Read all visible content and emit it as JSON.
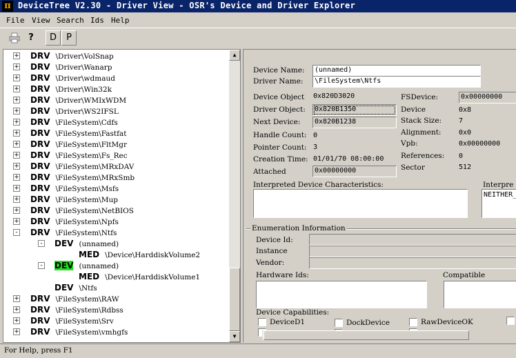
{
  "window": {
    "title": "DeviceTree V2.30 - Driver View - OSR's Device and Driver Explorer",
    "icon_glyph": "π"
  },
  "menu": [
    "File",
    "View",
    "Search",
    "Ids",
    "Help"
  ],
  "toolbar": {
    "print_icon": "printer-icon",
    "help_glyph": "?",
    "d_label": "D",
    "p_label": "P"
  },
  "tree": [
    {
      "level": 0,
      "expander": "+",
      "tag": "DRV",
      "path": "\\Driver\\VolSnap"
    },
    {
      "level": 0,
      "expander": "+",
      "tag": "DRV",
      "path": "\\Driver\\Wanarp"
    },
    {
      "level": 0,
      "expander": "+",
      "tag": "DRV",
      "path": "\\Driver\\wdmaud"
    },
    {
      "level": 0,
      "expander": "+",
      "tag": "DRV",
      "path": "\\Driver\\Win32k"
    },
    {
      "level": 0,
      "expander": "+",
      "tag": "DRV",
      "path": "\\Driver\\WMIxWDM"
    },
    {
      "level": 0,
      "expander": "+",
      "tag": "DRV",
      "path": "\\Driver\\WS2IFSL"
    },
    {
      "level": 0,
      "expander": "+",
      "tag": "DRV",
      "path": "\\FileSystem\\Cdfs"
    },
    {
      "level": 0,
      "expander": "+",
      "tag": "DRV",
      "path": "\\FileSystem\\Fastfat"
    },
    {
      "level": 0,
      "expander": "+",
      "tag": "DRV",
      "path": "\\FileSystem\\FltMgr"
    },
    {
      "level": 0,
      "expander": "+",
      "tag": "DRV",
      "path": "\\FileSystem\\Fs_Rec"
    },
    {
      "level": 0,
      "expander": "+",
      "tag": "DRV",
      "path": "\\FileSystem\\MRxDAV"
    },
    {
      "level": 0,
      "expander": "+",
      "tag": "DRV",
      "path": "\\FileSystem\\MRxSmb"
    },
    {
      "level": 0,
      "expander": "+",
      "tag": "DRV",
      "path": "\\FileSystem\\Msfs"
    },
    {
      "level": 0,
      "expander": "+",
      "tag": "DRV",
      "path": "\\FileSystem\\Mup"
    },
    {
      "level": 0,
      "expander": "+",
      "tag": "DRV",
      "path": "\\FileSystem\\NetBIOS"
    },
    {
      "level": 0,
      "expander": "+",
      "tag": "DRV",
      "path": "\\FileSystem\\Npfs"
    },
    {
      "level": 0,
      "expander": "-",
      "tag": "DRV",
      "path": "\\FileSystem\\Ntfs"
    },
    {
      "level": 1,
      "expander": "-",
      "tag": "DEV",
      "path": "(unnamed)"
    },
    {
      "level": 2,
      "expander": "",
      "tag": "MED",
      "path": "\\Device\\HarddiskVolume2"
    },
    {
      "level": 1,
      "expander": "-",
      "tag": "DEV",
      "path": "(unnamed)",
      "selected": true
    },
    {
      "level": 2,
      "expander": "",
      "tag": "MED",
      "path": "\\Device\\HarddiskVolume1"
    },
    {
      "level": 1,
      "expander": "",
      "tag": "DEV",
      "path": "\\Ntfs"
    },
    {
      "level": 0,
      "expander": "+",
      "tag": "DRV",
      "path": "\\FileSystem\\RAW"
    },
    {
      "level": 0,
      "expander": "+",
      "tag": "DRV",
      "path": "\\FileSystem\\Rdbss"
    },
    {
      "level": 0,
      "expander": "+",
      "tag": "DRV",
      "path": "\\FileSystem\\Srv"
    },
    {
      "level": 0,
      "expander": "+",
      "tag": "DRV",
      "path": "\\FileSystem\\vmhgfs"
    }
  ],
  "details": {
    "device_name_label": "Device Name:",
    "device_name": "(unnamed)",
    "driver_name_label": "Driver Name:",
    "driver_name": "\\FileSystem\\Ntfs",
    "device_object_label": "Device Object",
    "device_object": "0x820D3020",
    "driver_object_label": "Driver Object:",
    "driver_object": "0x820B1350",
    "next_device_label": "Next Device:",
    "next_device": "0x820B1238",
    "handle_count_label": "Handle Count:",
    "handle_count": "0",
    "pointer_count_label": "Pointer Count:",
    "pointer_count": "3",
    "creation_time_label": "Creation Time:",
    "creation_time": "01/01/70 08:00:00",
    "attached_label": "Attached",
    "attached": "0x00000000",
    "fsdevice_label": "FSDevice:",
    "fsdevice": "0x00000000",
    "device_label": "Device",
    "device": "0x8",
    "stack_size_label": "Stack Size:",
    "stack_size": "7",
    "alignment_label": "Alignment:",
    "alignment": "0x0",
    "vpb_label": "Vpb:",
    "vpb": "0x00000000",
    "references_label": "References:",
    "references": "0",
    "sector_label": "Sector",
    "sector": "512",
    "interp_dev_char_label": "Interpreted Device Characteristics:",
    "interp_label": "Interpre",
    "interp_value": "NEITHER_"
  },
  "enumeration": {
    "group_label": "Enumeration Information",
    "device_id_label": "Device Id:",
    "instance_label": "Instance",
    "vendor_label": "Vendor:",
    "hardware_ids_label": "Hardware Ids:",
    "compatible_label": "Compatible",
    "capabilities_label": "Device Capabilities:",
    "cap_d1": "DeviceD1",
    "cap_dock": "DockDevice",
    "cap_raw": "RawDeviceOK"
  },
  "status": {
    "text": "For Help, press F1"
  }
}
